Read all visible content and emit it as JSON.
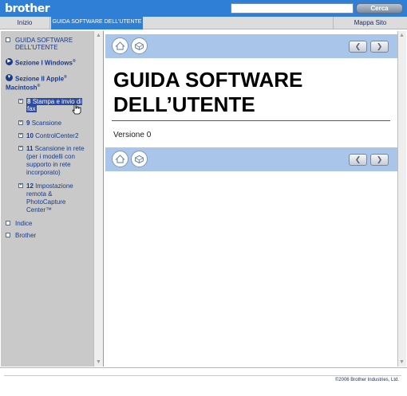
{
  "header": {
    "logo": "brother",
    "search_placeholder": "",
    "search_button": "Cerca"
  },
  "nav": {
    "home": "Inizio",
    "guide": "GUIDA SOFTWARE DELL'UTENTE",
    "sitemap": "Mappa Sito"
  },
  "sidebar": {
    "guide_title_1": "GUIDA SOFTWARE",
    "guide_title_2": "DELL'UTENTE",
    "section1": "Sezione I Windows",
    "section1_sup": "®",
    "section2_line1": "Sezione II Apple",
    "section2_sup": "®",
    "section2_line2": "Macintosh",
    "section2_sup2": "®",
    "chapters": [
      {
        "num": "8",
        "label_1": "Stampa e invio di",
        "label_2": "fax"
      },
      {
        "num": "9",
        "label_1": "Scansione"
      },
      {
        "num": "10",
        "label_1": "ControlCenter2"
      },
      {
        "num": "11",
        "label_1": "Scansione in rete",
        "label_2": "(per i modelli con",
        "label_3": "supporto in rete",
        "label_4": "incorporato)"
      },
      {
        "num": "12",
        "label_1": "Impostazione",
        "label_2": "remota &",
        "label_3": "PhotoCapture",
        "label_4": "Center™"
      }
    ],
    "index": "Indice",
    "brother": "Brother"
  },
  "main": {
    "title_line1": "GUIDA SOFTWARE",
    "title_line2": "DELL’UTENTE",
    "version": "Versione 0"
  },
  "footer": {
    "copyright": "©2006 Brother Industries, Ltd."
  },
  "icons": {
    "home": "home-icon",
    "print": "printer-icon",
    "prev": "chevron-left-icon",
    "next": "chevron-right-icon"
  },
  "colors": {
    "header_blue": "#2f7fd6",
    "nav_strip": "#a9c6ea",
    "sidebar_gray": "#c9c9c9",
    "link_blue": "#1a3a8a"
  }
}
